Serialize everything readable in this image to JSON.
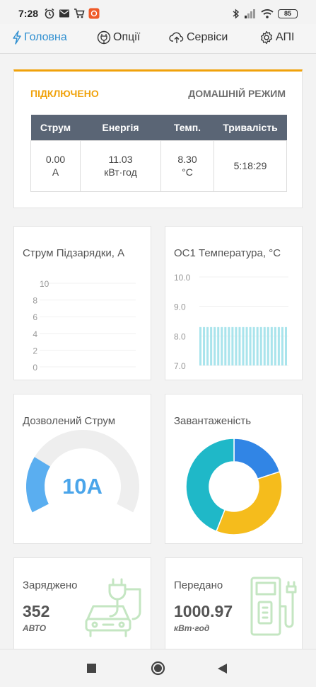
{
  "status_bar": {
    "time": "7:28",
    "battery": "85",
    "icons": [
      "alarm-icon",
      "mail-icon",
      "cart-icon",
      "app-icon",
      "bluetooth-icon",
      "signal-icon",
      "wifi-icon",
      "battery-icon"
    ]
  },
  "nav": {
    "items": [
      {
        "label": "Головна",
        "icon": "lightning-icon",
        "active": true
      },
      {
        "label": "Опції",
        "icon": "plug-bulb-icon",
        "active": false
      },
      {
        "label": "Сервіси",
        "icon": "cloud-upload-icon",
        "active": false
      },
      {
        "label": "АПІ",
        "icon": "gear-icon",
        "active": false
      }
    ]
  },
  "status": {
    "connection": "ПІДКЛЮЧЕНО",
    "mode": "ДОМАШНІЙ РЕЖИМ",
    "columns": [
      "Струм",
      "Енергія",
      "Темп.",
      "Тривалість"
    ],
    "values": [
      {
        "value": "0.00",
        "unit": "A"
      },
      {
        "value": "11.03",
        "unit": "кВт·год"
      },
      {
        "value": "8.30",
        "unit": "°C"
      },
      {
        "value": "5:18:29",
        "unit": ""
      }
    ]
  },
  "charging_current": {
    "title": "Струм Підзарядки, А",
    "chart_data": {
      "type": "line",
      "y_ticks": [
        0,
        2,
        4,
        6,
        8,
        10
      ],
      "ylim": [
        0,
        10
      ],
      "values": []
    }
  },
  "temperature": {
    "title": "ОС1 Температура, °C",
    "chart_data": {
      "type": "bar",
      "y_ticks": [
        "7.0",
        "8.0",
        "9.0",
        "10.0"
      ],
      "ylim": [
        7.0,
        10.0
      ],
      "values": [
        8.3,
        8.3,
        8.3,
        8.3,
        8.3,
        8.3,
        8.3,
        8.3,
        8.3,
        8.3,
        8.3,
        8.3,
        8.3,
        8.3,
        8.3,
        8.3,
        8.3,
        8.3,
        8.3,
        8.3,
        8.3,
        8.3,
        8.3,
        8.3,
        8.3
      ],
      "color": "#a9e4ec"
    }
  },
  "allowed_current": {
    "title": "Дозволений Струм",
    "value": "10A",
    "fraction": 0.25,
    "fill_color": "#5aaef0",
    "track_color": "#eeeeee"
  },
  "load": {
    "title": "Завантаженість",
    "chart_data": {
      "type": "pie",
      "slices": [
        {
          "value": 0.2,
          "color": "#3185e5"
        },
        {
          "value": 0.36,
          "color": "#f5bc1c"
        },
        {
          "value": 0.44,
          "color": "#1fb8c8"
        }
      ]
    }
  },
  "charged": {
    "title": "Заряджено",
    "value": "352",
    "unit": "АВТО",
    "icon": "car-charger-icon"
  },
  "delivered": {
    "title": "Передано",
    "value": "1000.97",
    "unit": "кВт·год",
    "icon": "fuel-station-icon"
  },
  "colors": {
    "accent": "#f0a20b",
    "nav_active": "#2f8fd0",
    "table_header": "#5a6575",
    "icon_green": "#c4e6c2"
  }
}
